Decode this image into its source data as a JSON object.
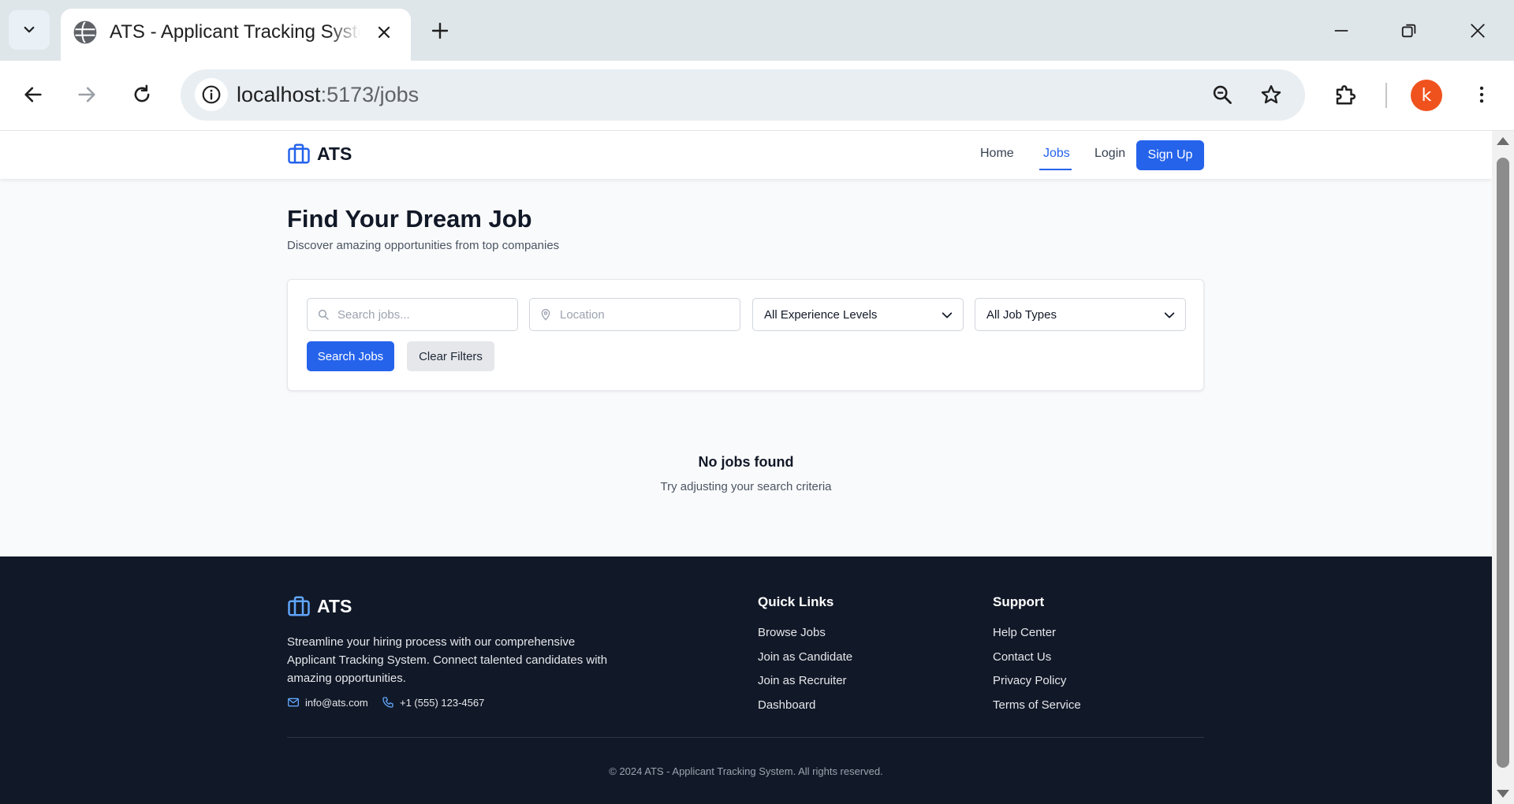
{
  "browser": {
    "tab_title": "ATS - Applicant Tracking System",
    "url_host": "localhost",
    "url_path": ":5173/jobs",
    "profile_initial": "k"
  },
  "nav": {
    "brand": "ATS",
    "links": {
      "home": "Home",
      "jobs": "Jobs",
      "login": "Login"
    },
    "signup": "Sign Up",
    "active": "Jobs"
  },
  "hero": {
    "title": "Find Your Dream Job",
    "subtitle": "Discover amazing opportunities from top companies"
  },
  "filters": {
    "search_placeholder": "Search jobs...",
    "search_value": "",
    "location_placeholder": "Location",
    "location_value": "",
    "experience_selected": "All Experience Levels",
    "job_type_selected": "All Job Types",
    "search_button": "Search Jobs",
    "clear_button": "Clear Filters"
  },
  "empty": {
    "title": "No jobs found",
    "subtitle": "Try adjusting your search criteria"
  },
  "footer": {
    "brand": "ATS",
    "description": "Streamline your hiring process with our comprehensive Applicant Tracking System. Connect talented candidates with amazing opportunities.",
    "email": "info@ats.com",
    "phone": "+1 (555) 123-4567",
    "quick_links_title": "Quick Links",
    "quick_links": [
      "Browse Jobs",
      "Join as Candidate",
      "Join as Recruiter",
      "Dashboard"
    ],
    "support_title": "Support",
    "support_links": [
      "Help Center",
      "Contact Us",
      "Privacy Policy",
      "Terms of Service"
    ],
    "copyright": "© 2024 ATS - Applicant Tracking System. All rights reserved."
  },
  "colors": {
    "primary": "#2563eb",
    "footer_bg": "#111827",
    "page_bg": "#f9fafb",
    "avatar": "#f0521e"
  },
  "icons": [
    "chevron-down-icon",
    "globe-icon",
    "close-icon",
    "plus-icon",
    "minimize-icon",
    "restore-icon",
    "back-icon",
    "forward-icon",
    "reload-icon",
    "info-icon",
    "zoom-icon",
    "star-icon",
    "extensions-icon",
    "more-icon",
    "briefcase-icon",
    "search-icon",
    "map-pin-icon",
    "mail-icon",
    "phone-icon"
  ]
}
